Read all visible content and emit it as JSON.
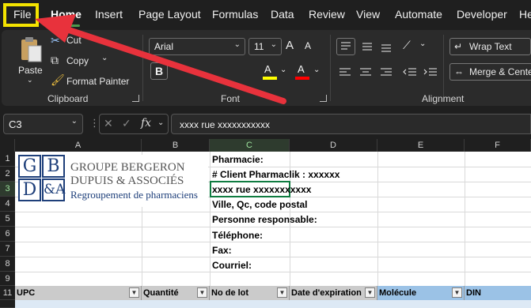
{
  "menu": {
    "tabs": [
      "File",
      "Home",
      "Insert",
      "Page Layout",
      "Formulas",
      "Data",
      "Review",
      "View",
      "Automate",
      "Developer",
      "He"
    ]
  },
  "ribbon": {
    "clipboard": {
      "paste": "Paste",
      "cut": "Cut",
      "copy": "Copy",
      "format_painter": "Format Painter",
      "label": "Clipboard"
    },
    "font": {
      "name": "Arial",
      "size": "11",
      "bold": "B",
      "grow": "A",
      "shrink": "A",
      "fill": "A",
      "color": "A",
      "label": "Font",
      "fill_color": "#ffff00",
      "font_color": "#ff0000"
    },
    "alignment": {
      "wrap_text": "Wrap Text",
      "merge_center": "Merge & Cente",
      "label": "Alignment"
    }
  },
  "formula_bar": {
    "name_box": "C3",
    "formula": "xxxx rue xxxxxxxxxxx"
  },
  "grid": {
    "columns": [
      "A",
      "B",
      "C",
      "D",
      "E",
      "F"
    ],
    "rows": [
      "1",
      "2",
      "3",
      "4",
      "5",
      "6",
      "7",
      "8",
      "9",
      "11"
    ],
    "logo": {
      "letters": [
        "G",
        "B",
        "D",
        "&A"
      ],
      "line1": "GROUPE BERGERON",
      "line2": "DUPUIS & ASSOCIÉS",
      "line3": "Regroupement de pharmaciens"
    },
    "info": [
      "Pharmacie:",
      "# Client Pharmaclik : xxxxxx",
      "xxxx rue xxxxxxxxxxx",
      "Ville, Qc, code postal",
      "Personne responsable:",
      "Téléphone:",
      "Fax:",
      "Courriel:"
    ],
    "table_headers": [
      "UPC",
      "Quantité",
      "No de lot",
      "Date d'expiration",
      "Molécule",
      "DIN"
    ]
  },
  "annotation": {
    "highlight_color": "#f4e300",
    "arrow_color": "#e8323c"
  }
}
